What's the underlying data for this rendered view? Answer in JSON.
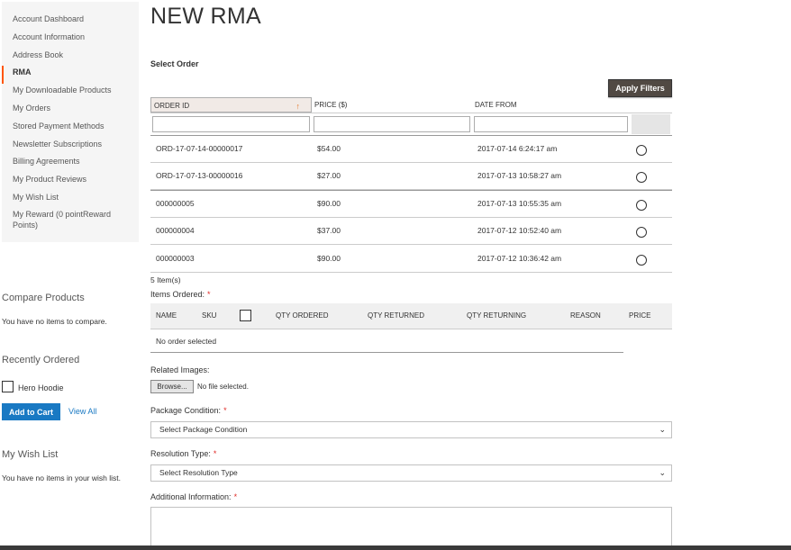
{
  "sidebar": {
    "items": [
      {
        "label": "Account Dashboard"
      },
      {
        "label": "Account Information"
      },
      {
        "label": "Address Book"
      },
      {
        "label": "RMA"
      },
      {
        "label": "My Downloadable Products"
      },
      {
        "label": "My Orders"
      },
      {
        "label": "Stored Payment Methods"
      },
      {
        "label": "Newsletter Subscriptions"
      },
      {
        "label": "Billing Agreements"
      },
      {
        "label": "My Product Reviews"
      },
      {
        "label": "My Wish List"
      },
      {
        "label": "My Reward (0 pointReward Points)"
      }
    ],
    "current_index": 3
  },
  "compare": {
    "title": "Compare Products",
    "empty_text": "You have no items to compare."
  },
  "recently_ordered": {
    "title": "Recently Ordered",
    "item_label": "Hero Hoodie",
    "add_to_cart": "Add to Cart",
    "view_all": "View All"
  },
  "wishlist": {
    "title": "My Wish List",
    "empty_text": "You have no items in your wish list."
  },
  "main": {
    "page_title": "NEW RMA",
    "select_order_label": "Select Order",
    "apply_filters": "Apply Filters",
    "grid": {
      "columns": [
        "ORDER ID",
        "PRICE ($)",
        "DATE FROM"
      ],
      "sort_arrow": "↑",
      "rows": [
        {
          "order_id": "ORD-17-07-14-00000017",
          "price": "$54.00",
          "date": "2017-07-14 6:24:17 am"
        },
        {
          "order_id": "ORD-17-07-13-00000016",
          "price": "$27.00",
          "date": "2017-07-13 10:58:27 am"
        },
        {
          "order_id": "000000005",
          "price": "$90.00",
          "date": "2017-07-13 10:55:35 am"
        },
        {
          "order_id": "000000004",
          "price": "$37.00",
          "date": "2017-07-12 10:52:40 am"
        },
        {
          "order_id": "000000003",
          "price": "$90.00",
          "date": "2017-07-12 10:36:42 am"
        }
      ]
    },
    "items_count": "5 Item(s)",
    "items_ordered_label": "Items Ordered:",
    "required_mark": "*",
    "items_columns": {
      "name": "NAME",
      "sku": "SKU",
      "qty_ordered": "QTY ORDERED",
      "qty_returned": "QTY RETURNED",
      "qty_returning": "QTY RETURNING",
      "reason": "REASON",
      "price": "PRICE"
    },
    "no_order_text": "No order selected",
    "related_images_label": "Related Images:",
    "browse_button": "Browse...",
    "no_file_text": "No file selected.",
    "package_condition_label": "Package Condition:",
    "package_condition_value": "Select Package Condition",
    "resolution_type_label": "Resolution Type:",
    "resolution_type_value": "Select Resolution Type",
    "additional_info_label": "Additional Information:"
  },
  "colors": {
    "accent_orange": "#ff5501",
    "link_blue": "#1979c3",
    "apply_button": "#514943",
    "required_red": "#e02b27"
  }
}
